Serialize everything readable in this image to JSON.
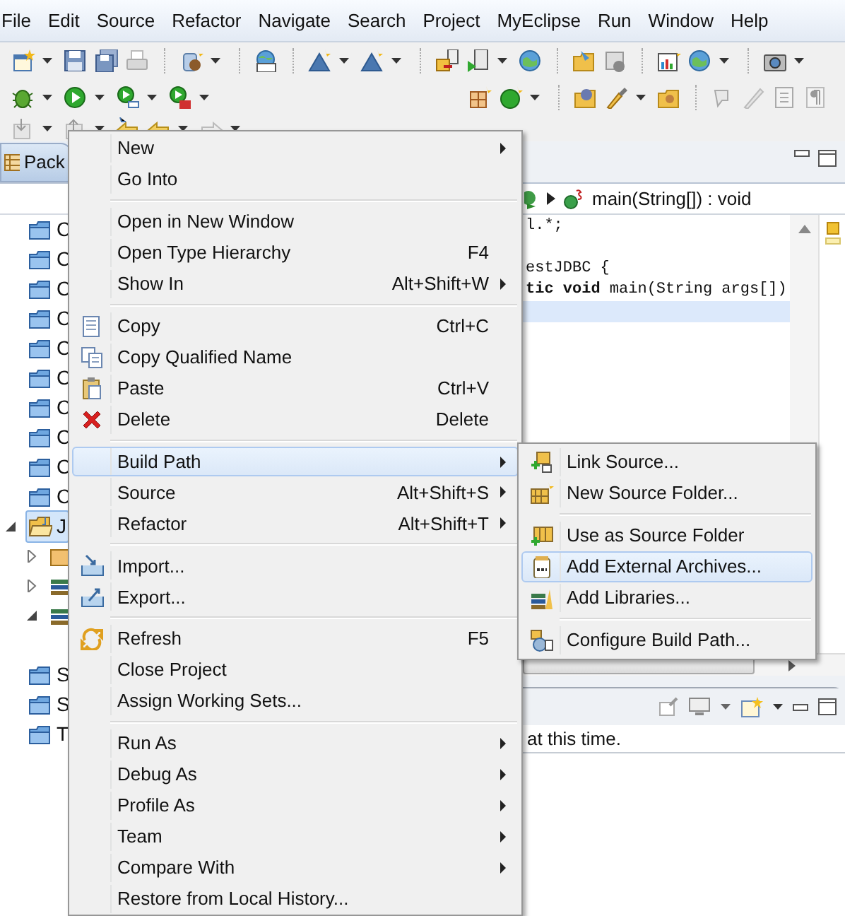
{
  "menu_bar": [
    "File",
    "Edit",
    "Source",
    "Refactor",
    "Navigate",
    "Search",
    "Project",
    "MyEclipse",
    "Run",
    "Window",
    "Help"
  ],
  "package_explorer": {
    "tab": "Pack",
    "items": [
      {
        "label": "C",
        "kind": "folder",
        "selected": false
      },
      {
        "label": "C",
        "kind": "folder",
        "selected": false
      },
      {
        "label": "C",
        "kind": "folder",
        "selected": false
      },
      {
        "label": "C",
        "kind": "folder",
        "selected": false
      },
      {
        "label": "C",
        "kind": "folder",
        "selected": false
      },
      {
        "label": "C",
        "kind": "folder",
        "selected": false
      },
      {
        "label": "C",
        "kind": "folder",
        "selected": false
      },
      {
        "label": "C",
        "kind": "folder",
        "selected": false
      },
      {
        "label": "C",
        "kind": "folder",
        "selected": false
      },
      {
        "label": "C",
        "kind": "folder",
        "selected": false
      },
      {
        "label": "J",
        "kind": "project",
        "expanded": true,
        "selected": true,
        "children": [
          {
            "kind": "package",
            "expanded": false
          },
          {
            "kind": "library",
            "expanded": false
          },
          {
            "kind": "library",
            "expanded": true
          }
        ]
      },
      {
        "label": "S",
        "kind": "folder",
        "selected": false
      },
      {
        "label": "S",
        "kind": "folder",
        "selected": false
      },
      {
        "label": "T",
        "kind": "folder",
        "selected": false
      }
    ]
  },
  "editor": {
    "breadcrumb": "main(String[]) : void",
    "lines": [
      {
        "text": "l.*;",
        "current": false
      },
      {
        "current": false
      },
      {
        "text": "estJDBC {",
        "current": false
      },
      {
        "text": "**tic** **void** main(String args[])",
        "current": false
      },
      {
        "current": true
      }
    ]
  },
  "bottom_panel": {
    "message": "at this time."
  },
  "context_menu": {
    "items": [
      {
        "kind": "plain",
        "label": "New",
        "submenu": true,
        "selected": false
      },
      {
        "kind": "plain",
        "label": "Go Into",
        "submenu": false,
        "selected": false
      },
      {
        "kind": "separator"
      },
      {
        "kind": "plain",
        "label": "Open in New Window",
        "submenu": false,
        "selected": false
      },
      {
        "kind": "plain",
        "label": "Open Type Hierarchy",
        "shortcut": "F4",
        "submenu": false,
        "selected": false
      },
      {
        "kind": "plain",
        "label": "Show In",
        "shortcut": "Alt+Shift+W",
        "submenu": true,
        "selected": false
      },
      {
        "kind": "separator"
      },
      {
        "kind": "copy",
        "label": "Copy",
        "shortcut": "Ctrl+C",
        "submenu": false,
        "selected": false
      },
      {
        "kind": "copy-name",
        "label": "Copy Qualified Name",
        "submenu": false,
        "selected": false
      },
      {
        "kind": "paste",
        "label": "Paste",
        "shortcut": "Ctrl+V",
        "submenu": false,
        "selected": false
      },
      {
        "kind": "delete",
        "label": "Delete",
        "shortcut": "Delete",
        "submenu": false,
        "selected": false
      },
      {
        "kind": "separator"
      },
      {
        "kind": "plain",
        "label": "Build Path",
        "submenu": true,
        "selected": true
      },
      {
        "kind": "plain",
        "label": "Source",
        "shortcut": "Alt+Shift+S",
        "submenu": true,
        "selected": false
      },
      {
        "kind": "plain",
        "label": "Refactor",
        "shortcut": "Alt+Shift+T",
        "submenu": true,
        "selected": false
      },
      {
        "kind": "separator"
      },
      {
        "kind": "import",
        "label": "Import...",
        "submenu": false,
        "selected": false
      },
      {
        "kind": "export",
        "label": "Export...",
        "submenu": false,
        "selected": false
      },
      {
        "kind": "separator"
      },
      {
        "kind": "refresh",
        "label": "Refresh",
        "shortcut": "F5",
        "submenu": false,
        "selected": false
      },
      {
        "kind": "plain",
        "label": "Close Project",
        "submenu": false,
        "selected": false
      },
      {
        "kind": "plain",
        "label": "Assign Working Sets...",
        "submenu": false,
        "selected": false
      },
      {
        "kind": "separator"
      },
      {
        "kind": "plain",
        "label": "Run As",
        "submenu": true,
        "selected": false
      },
      {
        "kind": "plain",
        "label": "Debug As",
        "submenu": true,
        "selected": false
      },
      {
        "kind": "plain",
        "label": "Profile As",
        "submenu": true,
        "selected": false
      },
      {
        "kind": "plain",
        "label": "Team",
        "submenu": true,
        "selected": false
      },
      {
        "kind": "plain",
        "label": "Compare With",
        "submenu": true,
        "selected": false
      },
      {
        "kind": "plain",
        "label": "Restore from Local History...",
        "submenu": false,
        "selected": false
      }
    ]
  },
  "submenu": {
    "items": [
      {
        "kind": "link-source",
        "label": "Link Source...",
        "selected": false
      },
      {
        "kind": "new-folder",
        "label": "New Source Folder...",
        "selected": false
      },
      {
        "kind": "separator"
      },
      {
        "kind": "source-folder",
        "label": "Use as Source Folder",
        "selected": false
      },
      {
        "kind": "archive",
        "label": "Add External Archives...",
        "selected": true
      },
      {
        "kind": "library",
        "label": "Add Libraries...",
        "selected": false
      },
      {
        "kind": "separator"
      },
      {
        "kind": "configure",
        "label": "Configure Build Path...",
        "selected": false
      }
    ]
  }
}
